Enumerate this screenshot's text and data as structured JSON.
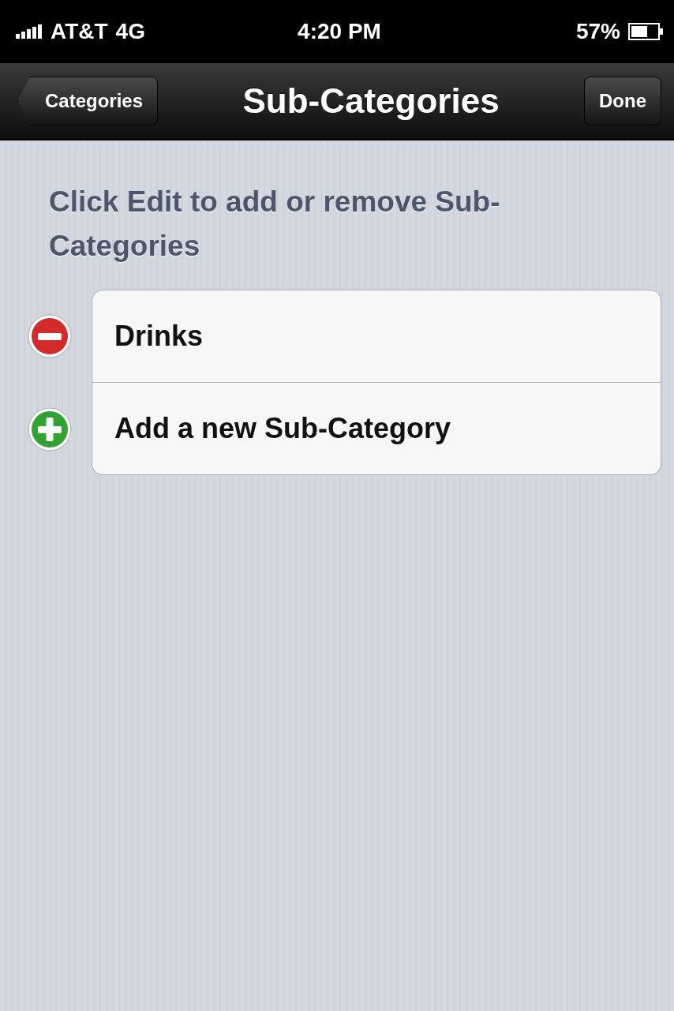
{
  "status_bar": {
    "carrier": "AT&T",
    "network": "4G",
    "time": "4:20 PM",
    "battery": "57%"
  },
  "nav_bar": {
    "back_button": "Categories",
    "title": "Sub-Categories",
    "done_button": "Done"
  },
  "header": "Click Edit to add or remove Sub-Categories",
  "rows": [
    {
      "kind": "delete",
      "label": "Drinks"
    },
    {
      "kind": "insert",
      "label": "Add a new Sub-Category"
    }
  ]
}
